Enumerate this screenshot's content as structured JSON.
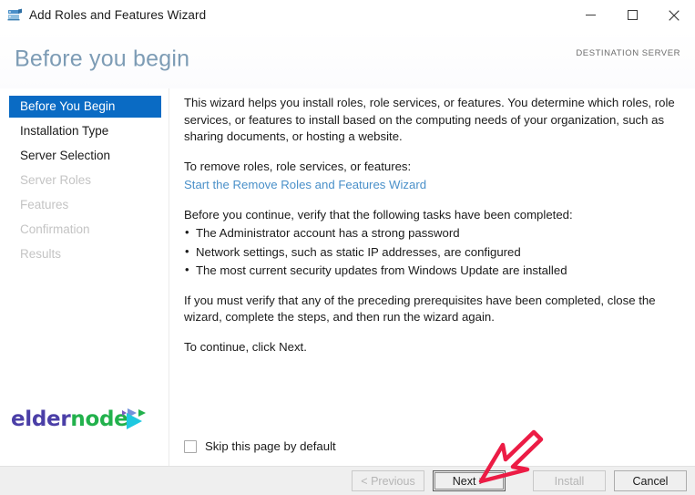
{
  "window": {
    "title": "Add Roles and Features Wizard",
    "icon": "server-wizard-icon",
    "controls": {
      "minimize": "—",
      "maximize": "□",
      "close": "✕"
    }
  },
  "header": {
    "page_title": "Before you begin",
    "destination_server_label": "DESTINATION SERVER"
  },
  "sidebar": {
    "items": [
      {
        "label": "Before You Begin",
        "state": "selected"
      },
      {
        "label": "Installation Type",
        "state": "enabled"
      },
      {
        "label": "Server Selection",
        "state": "enabled"
      },
      {
        "label": "Server Roles",
        "state": "disabled"
      },
      {
        "label": "Features",
        "state": "disabled"
      },
      {
        "label": "Confirmation",
        "state": "disabled"
      },
      {
        "label": "Results",
        "state": "disabled"
      }
    ]
  },
  "content": {
    "intro": "This wizard helps you install roles, role services, or features. You determine which roles, role services, or features to install based on the computing needs of your organization, such as sharing documents, or hosting a website.",
    "remove_prompt": "To remove roles, role services, or features:",
    "remove_link": "Start the Remove Roles and Features Wizard",
    "verify_prompt": "Before you continue, verify that the following tasks have been completed:",
    "tasks": [
      "The Administrator account has a strong password",
      "Network settings, such as static IP addresses, are configured",
      "The most current security updates from Windows Update are installed"
    ],
    "rerun_note": "If you must verify that any of the preceding prerequisites have been completed, close the wizard, complete the steps, and then run the wizard again.",
    "continue_note": "To continue, click Next.",
    "skip_checkbox_label": "Skip this page by default",
    "skip_checkbox_checked": false
  },
  "footer": {
    "buttons": [
      {
        "label": "< Previous",
        "state": "disabled"
      },
      {
        "label": "Next >",
        "state": "focused"
      },
      {
        "label": "Install",
        "state": "disabled"
      },
      {
        "label": "Cancel",
        "state": "enabled"
      }
    ]
  },
  "watermark": {
    "part_one": "elder",
    "part_two": "node",
    "color_one": "#4b3fa7",
    "color_two": "#22b14c"
  },
  "annotation": {
    "type": "hand-drawn-arrow",
    "points_to": "Next >",
    "color": "#ec1c45"
  },
  "colors": {
    "accent_blue": "#0a6bc4",
    "link_blue": "#4a90c9",
    "title_blue_gray": "#7d9cb5",
    "footer_gray": "#efefef"
  }
}
